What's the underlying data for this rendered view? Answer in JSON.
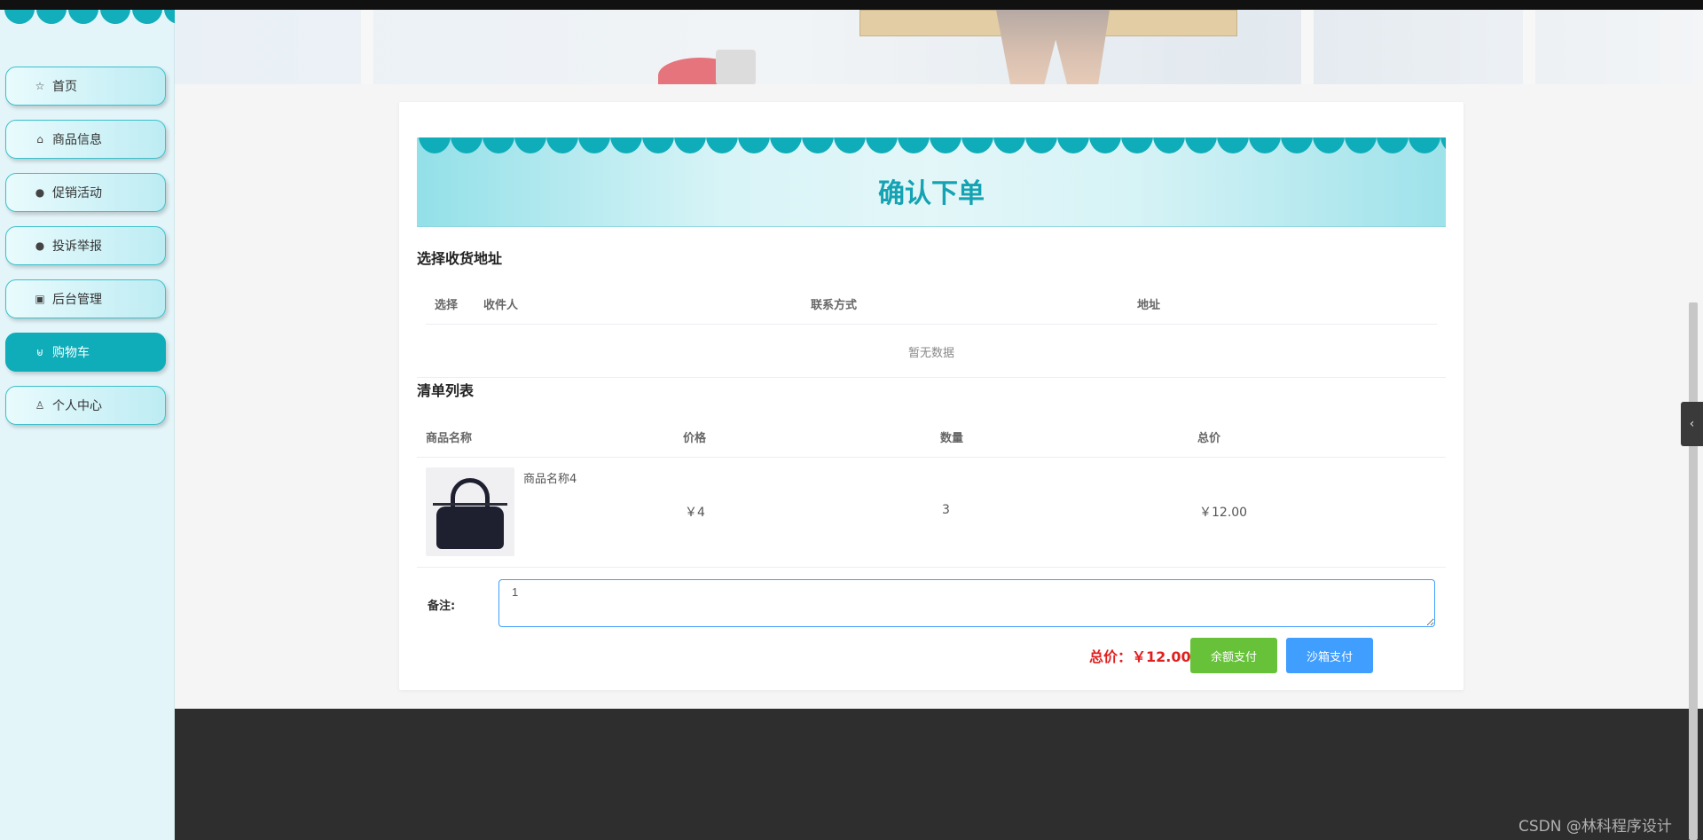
{
  "sidebar": {
    "items": [
      {
        "label": "首页",
        "icon": "star-icon",
        "active": false
      },
      {
        "label": "商品信息",
        "icon": "bag-icon",
        "active": false
      },
      {
        "label": "促销活动",
        "icon": "alert-icon",
        "active": false
      },
      {
        "label": "投诉举报",
        "icon": "question-icon",
        "active": false
      },
      {
        "label": "后台管理",
        "icon": "box-icon",
        "active": false
      },
      {
        "label": "购物车",
        "icon": "cart-icon",
        "active": true
      },
      {
        "label": "个人中心",
        "icon": "user-icon",
        "active": false
      }
    ]
  },
  "order": {
    "title": "确认下单",
    "address_section": {
      "title": "选择收货地址",
      "columns": [
        "选择",
        "收件人",
        "联系方式",
        "地址"
      ],
      "empty_text": "暂无数据"
    },
    "items_section": {
      "title": "清单列表",
      "columns": [
        "商品名称",
        "价格",
        "数量",
        "总价"
      ],
      "rows": [
        {
          "name": "商品名称4",
          "price": "￥4",
          "quantity": "3",
          "total": "￥12.00"
        }
      ]
    },
    "note_label": "备注:",
    "note_value": "1",
    "total_label": "总价：￥12.00",
    "buttons": {
      "balance_pay": "余额支付",
      "sandbox_pay": "沙箱支付"
    }
  },
  "watermark": "CSDN @林科程序设计",
  "colors": {
    "accent": "#0fadb9",
    "title": "#15a3b3",
    "total": "#e02020",
    "green": "#67c23a",
    "blue": "#409eff",
    "footer": "#2e2e2e"
  }
}
